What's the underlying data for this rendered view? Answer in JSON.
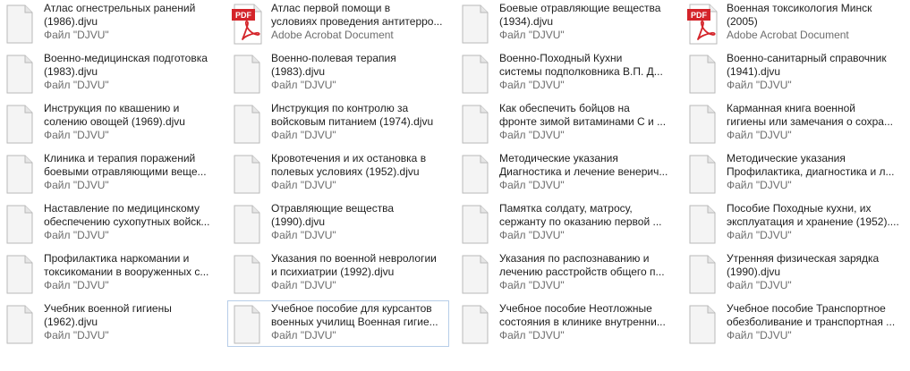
{
  "window": {
    "title": ""
  },
  "files": [
    {
      "line1": "Атлас огнестрельных ранений",
      "line2": "(1986).djvu",
      "type": "Файл \"DJVU\"",
      "icon": "document-icon"
    },
    {
      "line1": "Атлас первой помощи в",
      "line2": "условиях проведения антитерро...",
      "type": "Adobe Acrobat Document",
      "icon": "pdf-icon"
    },
    {
      "line1": "Боевые отравляющие вещества",
      "line2": "(1934).djvu",
      "type": "Файл \"DJVU\"",
      "icon": "document-icon"
    },
    {
      "line1": "Военная токсикология Минск",
      "line2": "(2005)",
      "type": "Adobe Acrobat Document",
      "icon": "pdf-icon"
    },
    {
      "line1": "Военно-медицинская подготовка",
      "line2": "(1983).djvu",
      "type": "Файл \"DJVU\"",
      "icon": "document-icon"
    },
    {
      "line1": "Военно-полевая терапия",
      "line2": "(1983).djvu",
      "type": "Файл \"DJVU\"",
      "icon": "document-icon"
    },
    {
      "line1": "Военно-Походный Кухни",
      "line2": "системы подполковника В.П. Д...",
      "type": "Файл \"DJVU\"",
      "icon": "document-icon"
    },
    {
      "line1": "Военно-санитарный справочник",
      "line2": "(1941).djvu",
      "type": "Файл \"DJVU\"",
      "icon": "document-icon"
    },
    {
      "line1": "Инструкция по квашению и",
      "line2": "солению овощей (1969).djvu",
      "type": "Файл \"DJVU\"",
      "icon": "document-icon"
    },
    {
      "line1": "Инструкция по контролю за",
      "line2": "войсковым питанием (1974).djvu",
      "type": "Файл \"DJVU\"",
      "icon": "document-icon"
    },
    {
      "line1": "Как обеспечить бойцов на",
      "line2": "фронте зимой витаминами С и ...",
      "type": "Файл \"DJVU\"",
      "icon": "document-icon"
    },
    {
      "line1": "Карманная книга военной",
      "line2": "гигиены или замечания о сохра...",
      "type": "Файл \"DJVU\"",
      "icon": "document-icon"
    },
    {
      "line1": "Клиника и терапия поражений",
      "line2": "боевыми отравляющими веще...",
      "type": "Файл \"DJVU\"",
      "icon": "document-icon"
    },
    {
      "line1": "Кровотечения и их остановка в",
      "line2": "полевых условиях (1952).djvu",
      "type": "Файл \"DJVU\"",
      "icon": "document-icon"
    },
    {
      "line1": "Методические указания",
      "line2": "Диагностика и лечение венерич...",
      "type": "Файл \"DJVU\"",
      "icon": "document-icon"
    },
    {
      "line1": "Методические указания",
      "line2": "Профилактика, диагностика и л...",
      "type": "Файл \"DJVU\"",
      "icon": "document-icon"
    },
    {
      "line1": "Наставление по медицинскому",
      "line2": "обеспечению сухопутных войск...",
      "type": "Файл \"DJVU\"",
      "icon": "document-icon"
    },
    {
      "line1": "Отравляющие вещества",
      "line2": "(1990).djvu",
      "type": "Файл \"DJVU\"",
      "icon": "document-icon"
    },
    {
      "line1": "Памятка солдату, матросу,",
      "line2": "сержанту по оказанию первой ...",
      "type": "Файл \"DJVU\"",
      "icon": "document-icon"
    },
    {
      "line1": "Пособие Походные кухни, их",
      "line2": "эксплуатация и хранение (1952)....",
      "type": "Файл \"DJVU\"",
      "icon": "document-icon"
    },
    {
      "line1": "Профилактика наркомании и",
      "line2": "токсикомании в вооруженных с...",
      "type": "Файл \"DJVU\"",
      "icon": "document-icon"
    },
    {
      "line1": "Указания по военной неврологии",
      "line2": "и психиатрии (1992).djvu",
      "type": "Файл \"DJVU\"",
      "icon": "document-icon"
    },
    {
      "line1": "Указания по распознаванию и",
      "line2": "лечению расстройств общего п...",
      "type": "Файл \"DJVU\"",
      "icon": "document-icon"
    },
    {
      "line1": "Утренняя физическая зарядка",
      "line2": "(1990).djvu",
      "type": "Файл \"DJVU\"",
      "icon": "document-icon"
    },
    {
      "line1": "Учебник военной гигиены",
      "line2": "(1962).djvu",
      "type": "Файл \"DJVU\"",
      "icon": "document-icon"
    },
    {
      "line1": "Учебное пособие для курсантов",
      "line2": "военных училищ Военная гигие...",
      "type": "Файл \"DJVU\"",
      "icon": "document-icon",
      "focused": true
    },
    {
      "line1": "Учебное пособие Неотложные",
      "line2": "состояния в клинике внутренни...",
      "type": "Файл \"DJVU\"",
      "icon": "document-icon"
    },
    {
      "line1": "Учебное пособие Транспортное",
      "line2": "обезболивание и транспортная ...",
      "type": "Файл \"DJVU\"",
      "icon": "document-icon"
    }
  ],
  "pdf_badge": "PDF",
  "colors": {
    "text": "#1e1e1e",
    "subtext": "#6d6d6d",
    "focus_border": "#b7cde8",
    "pdf_red": "#d4242a"
  }
}
